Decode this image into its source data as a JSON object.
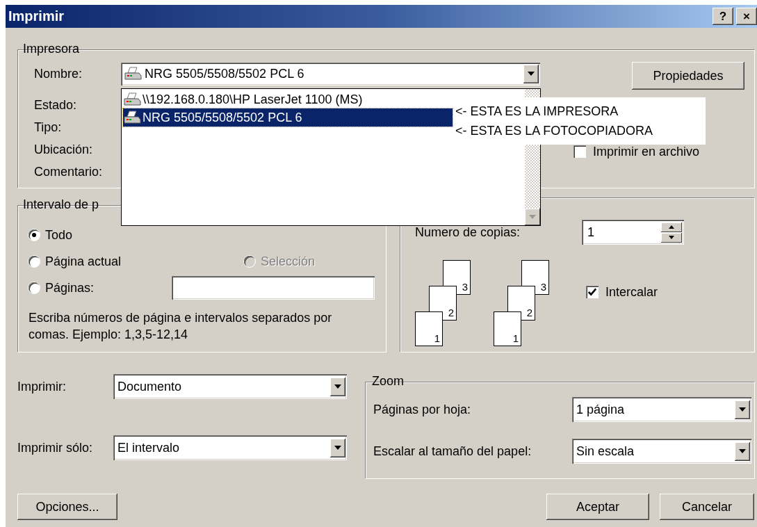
{
  "window": {
    "title": "Imprimir",
    "title_buttons": [
      "?",
      "×"
    ]
  },
  "printer": {
    "label": "Impresora",
    "name_label": "Nombre:",
    "name_value": "NRG 5505/5508/5502 PCL 6",
    "properties_button": "Propiedades",
    "info_labels": [
      "Estado:",
      "Tipo:",
      "Ubicación:",
      "Comentario:"
    ],
    "print_to_file": {
      "label": "Imprimir en archivo",
      "checked": false
    },
    "dropdown": {
      "expanded": true,
      "items": [
        {
          "label": "\\\\192.168.0.180\\HP LaserJet 1100 (MS)",
          "selected": false
        },
        {
          "label": "NRG 5505/5508/5502 PCL 6",
          "selected": true
        }
      ]
    }
  },
  "annotation": [
    "<- ESTA ES LA IMPRESORA",
    "<- ESTA ES LA FOTOCOPIADORA"
  ],
  "page_range": {
    "label": "Intervalo de p",
    "options": [
      {
        "label": "Todo",
        "selected": true,
        "disabled": false
      },
      {
        "label": "Página actual",
        "selected": false,
        "disabled": false
      },
      {
        "label": "Selección",
        "selected": false,
        "disabled": true
      },
      {
        "label": "Páginas:",
        "selected": false,
        "disabled": false
      }
    ],
    "hint": "Escriba números de página e intervalos separados por comas. Ejemplo: 1,3,5-12,14"
  },
  "copies": {
    "label": "Numero de copias:",
    "value": "1",
    "collate_stacks": [
      {
        "pages": [
          "1",
          "2",
          "3"
        ]
      },
      {
        "pages": [
          "1",
          "2",
          "3"
        ]
      }
    ],
    "collate": {
      "label": "Intercalar",
      "checked": true
    }
  },
  "print_what": {
    "label": "Imprimir:",
    "value": "Documento"
  },
  "print_only": {
    "label": "Imprimir sólo:",
    "value": "El intervalo"
  },
  "zoom": {
    "label": "Zoom",
    "pages_per_sheet": {
      "label": "Páginas por hoja:",
      "value": "1 página"
    },
    "scale": {
      "label": "Escalar al tamaño del papel:",
      "value": "Sin escala"
    }
  },
  "buttons": [
    "Opciones...",
    "Aceptar",
    "Cancelar"
  ]
}
